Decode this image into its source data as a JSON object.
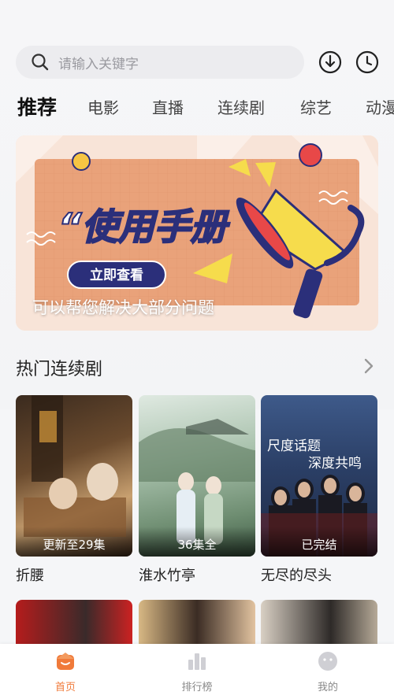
{
  "search": {
    "placeholder": "请输入关键字"
  },
  "tabs": [
    {
      "label": "推荐",
      "active": true
    },
    {
      "label": "电影"
    },
    {
      "label": "直播"
    },
    {
      "label": "连续剧"
    },
    {
      "label": "综艺"
    },
    {
      "label": "动漫"
    }
  ],
  "banner": {
    "title": "“使用手册",
    "button": "立即查看",
    "caption": "可以帮您解决大部分问题"
  },
  "hot_series": {
    "title": "热门连续剧",
    "items": [
      {
        "title": "折腰",
        "badge": "更新至29集"
      },
      {
        "title": "淮水竹亭",
        "badge": "36集全"
      },
      {
        "title": "无尽的尽头",
        "badge": "已完结",
        "poster_text_1": "尺度话题",
        "poster_text_2": "深度共鸣"
      }
    ]
  },
  "bottom_nav": [
    {
      "label": "首页",
      "icon": "home-icon",
      "active": true
    },
    {
      "label": "排行榜",
      "icon": "chart-icon"
    },
    {
      "label": "我的",
      "icon": "profile-icon"
    }
  ],
  "colors": {
    "accent": "#f07a3a",
    "banner_panel": "#e9a27a",
    "banner_button": "#2b2f7a"
  }
}
